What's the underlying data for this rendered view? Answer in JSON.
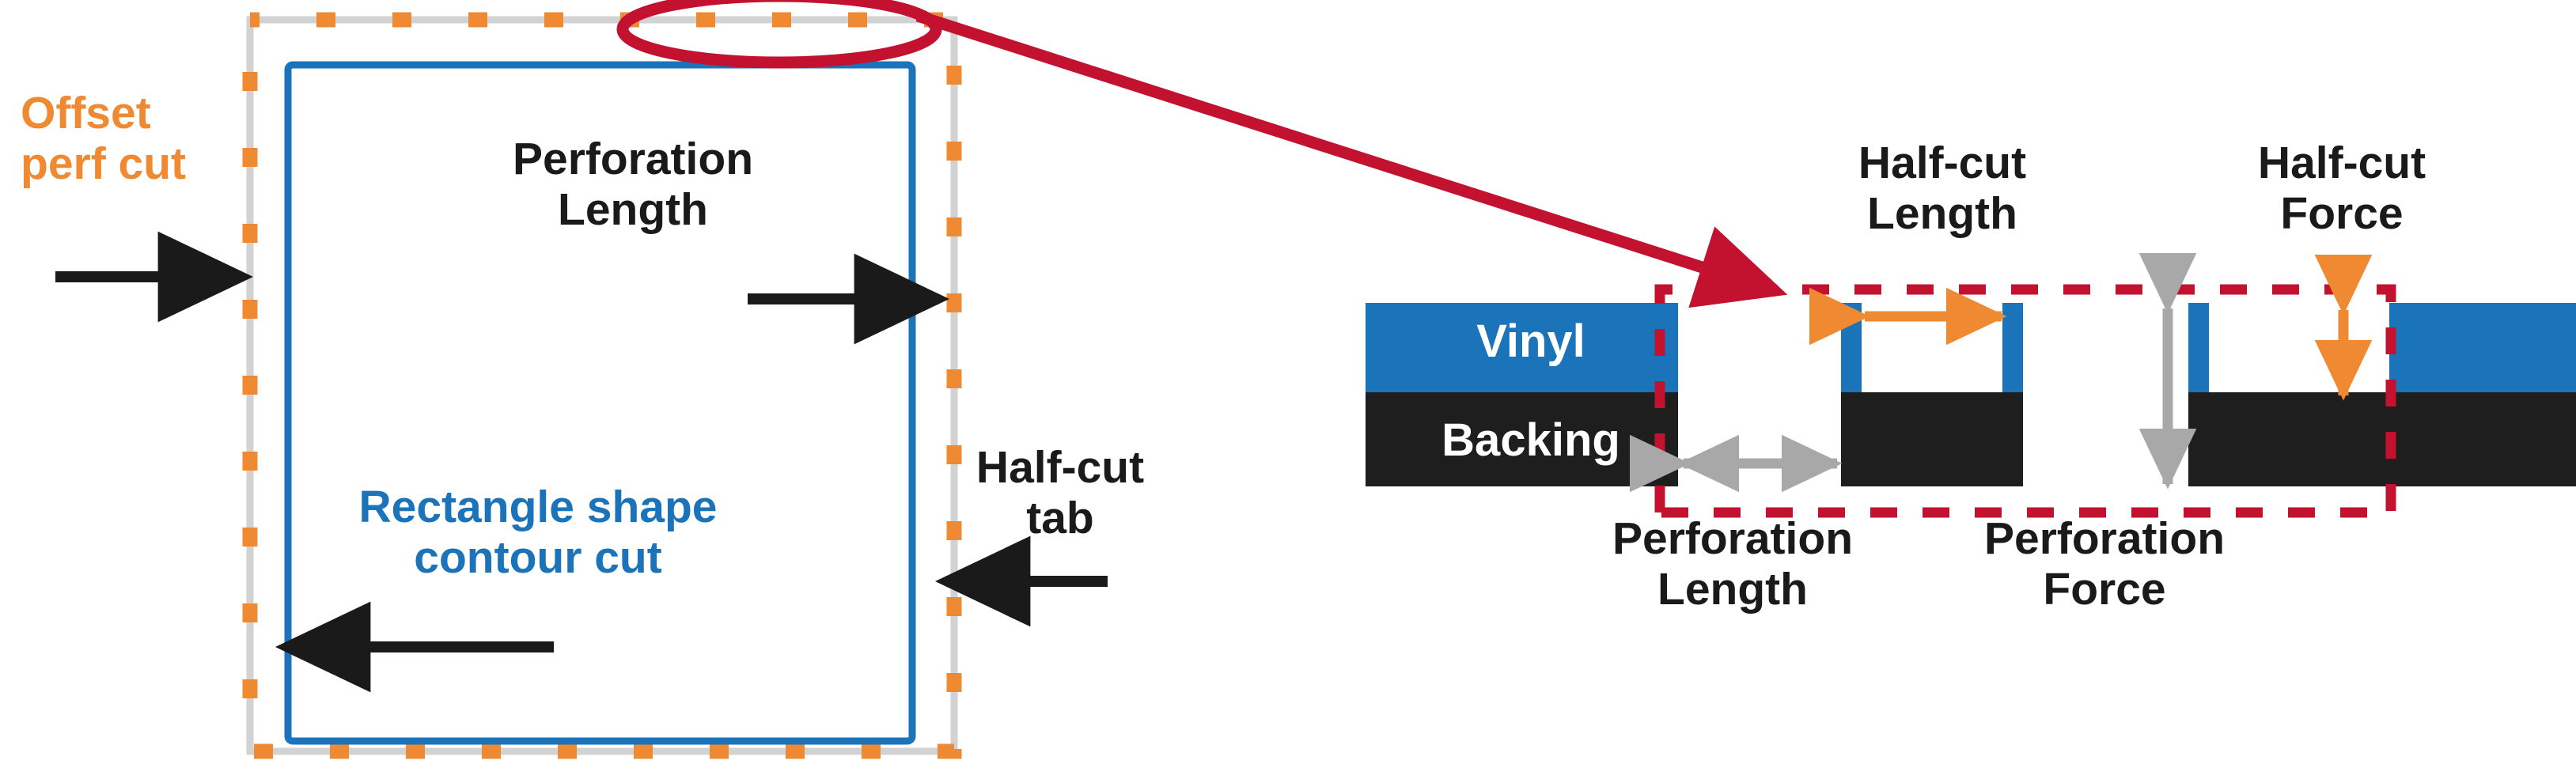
{
  "diagram": {
    "title": "Perforation and half-cut vinyl cutting diagram",
    "colors": {
      "orange": "#ef8a33",
      "blue": "#1b73b9",
      "crimson": "#c3122f",
      "gray": "#a8a8a8",
      "light_gray": "#d2d2d2",
      "black": "#1a1a1a",
      "white": "#ffffff"
    }
  },
  "left_panel": {
    "labels": {
      "offset_perf_cut": "Offset\nperf cut",
      "perforation_length": "Perforation\nLength",
      "rectangle_shape_contour_cut": "Rectangle shape\ncontour cut",
      "half_cut_tab": "Half-cut\ntab"
    }
  },
  "right_panel": {
    "labels": {
      "vinyl": "Vinyl",
      "backing": "Backing",
      "half_cut_length": "Half-cut\nLength",
      "half_cut_force": "Half-cut\nForce",
      "perforation_length": "Perforation\nLength",
      "perforation_force": "Perforation\nForce"
    }
  }
}
